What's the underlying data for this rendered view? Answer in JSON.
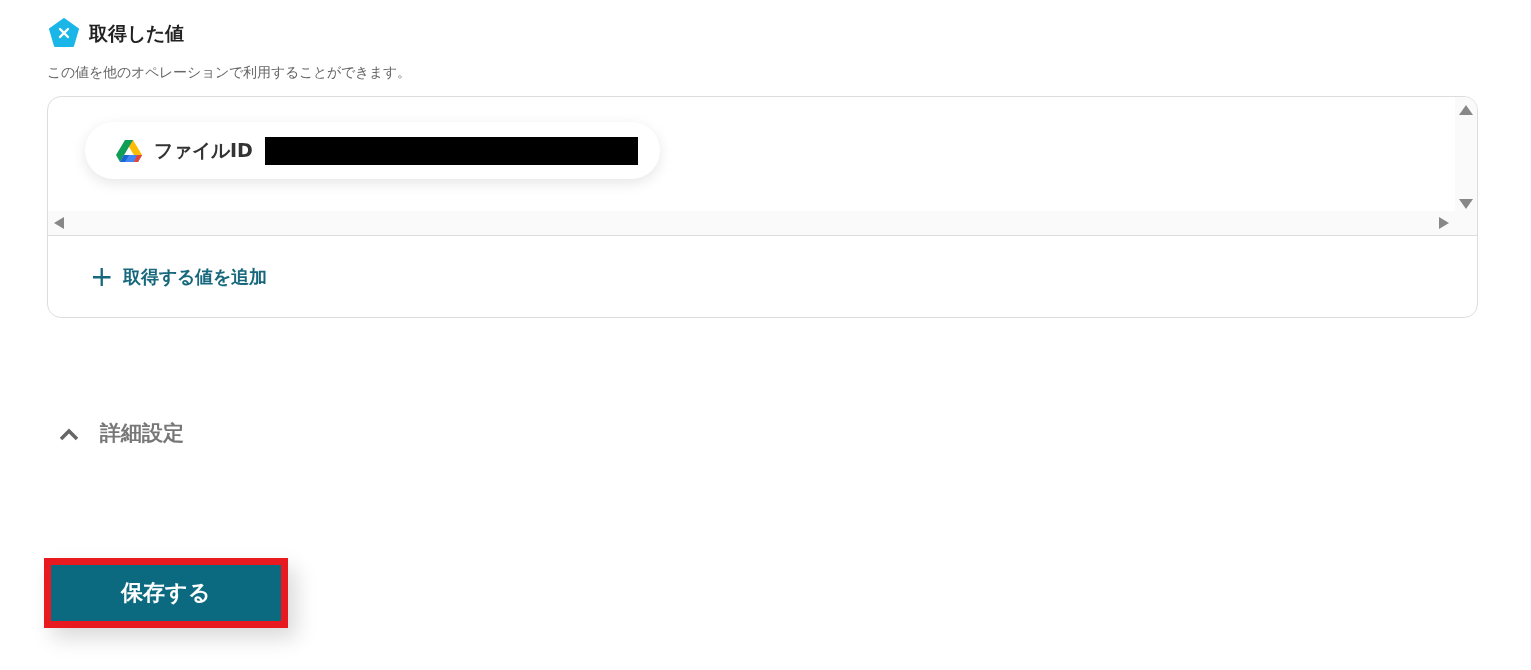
{
  "section": {
    "title": "取得した値",
    "description": "この値を他のオペレーションで利用することができます。"
  },
  "values": [
    {
      "label": "ファイルID",
      "redacted": true
    }
  ],
  "add_button": {
    "icon": "+",
    "label": "取得する値を追加"
  },
  "advanced": {
    "label": "詳細設定",
    "expanded": true
  },
  "save_button": {
    "label": "保存する",
    "highlighted": true
  }
}
